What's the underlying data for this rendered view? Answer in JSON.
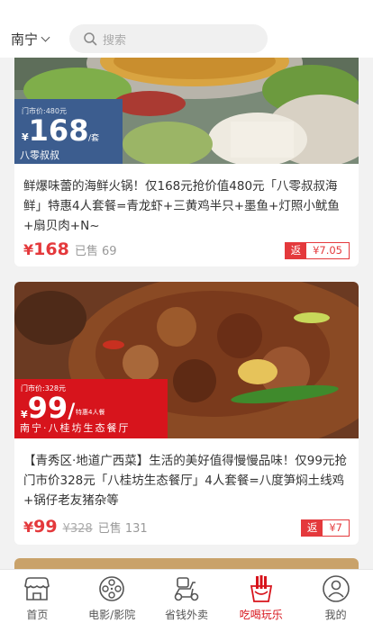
{
  "header": {
    "city": "南宁",
    "search_placeholder": "搜索"
  },
  "deals": [
    {
      "banner": {
        "market_price": "门市价:480元",
        "price": "168",
        "unit": "/套",
        "name": "八零叔叔"
      },
      "description": "鲜爆味蕾的海鲜火锅！仅168元抢价值480元「八零叔叔海鲜」特惠4人套餐=青龙虾+三黄鸡半只+墨鱼+灯照小鱿鱼+扇贝肉+N~",
      "price": "168",
      "currency": "¥",
      "original_price": "",
      "sold": "已售 69",
      "rebate_label": "返",
      "rebate_amount": "¥7.05"
    },
    {
      "banner": {
        "market_price": "门市价:328元",
        "price": "99",
        "unit": "/",
        "sub": "特惠4人餐",
        "name": "南宁·八桂坊生态餐厅"
      },
      "description": "【青秀区·地道广西菜】生活的美好值得慢慢品味！仅99元抢门市价328元「八桂坊生态餐厅」4人套餐=八度笋焖土线鸡+锅仔老友猪杂等",
      "price": "99",
      "currency": "¥",
      "original_price": "¥328",
      "sold": "已售 131",
      "rebate_label": "返",
      "rebate_amount": "¥7"
    }
  ],
  "tabs": [
    {
      "label": "首页",
      "icon": "shop-icon",
      "active": false
    },
    {
      "label": "电影/影院",
      "icon": "film-reel-icon",
      "active": false
    },
    {
      "label": "省钱外卖",
      "icon": "scooter-icon",
      "active": false
    },
    {
      "label": "吃喝玩乐",
      "icon": "fries-icon",
      "active": true
    },
    {
      "label": "我的",
      "icon": "user-icon",
      "active": false
    }
  ],
  "colors": {
    "accent": "#e4393c",
    "tab_active": "#d7141c",
    "banner_blue": "#3c5d8f",
    "banner_red": "#d7141c"
  }
}
